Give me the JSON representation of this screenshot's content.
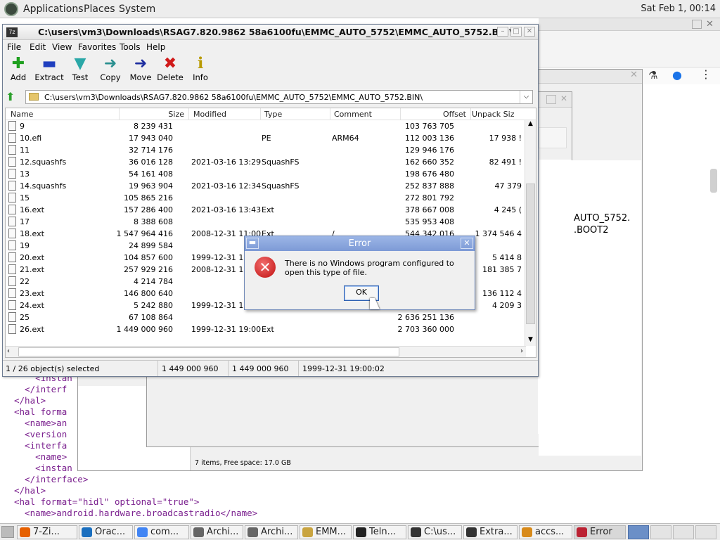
{
  "top_panel": {
    "applications": "Applications",
    "places": "Places",
    "system": "System",
    "clock": "Sat Feb 1, 00:14"
  },
  "window": {
    "title": "C:\\users\\vm3\\Downloads\\RSAG7.820.9862 58a6100fu\\EMMC_AUTO_5752\\EMMC_AUTO_5752.BIN\\",
    "menu": [
      "File",
      "Edit",
      "View",
      "Favorites",
      "Tools",
      "Help"
    ],
    "toolbar": [
      {
        "label": "Add",
        "icon": "add-icon"
      },
      {
        "label": "Extract",
        "icon": "extract-icon"
      },
      {
        "label": "Test",
        "icon": "test-icon"
      },
      {
        "label": "Copy",
        "icon": "copy-icon"
      },
      {
        "label": "Move",
        "icon": "move-icon"
      },
      {
        "label": "Delete",
        "icon": "delete-icon"
      },
      {
        "label": "Info",
        "icon": "info-icon"
      }
    ],
    "address": "C:\\users\\vm3\\Downloads\\RSAG7.820.9862 58a6100fu\\EMMC_AUTO_5752\\EMMC_AUTO_5752.BIN\\",
    "columns": [
      "Name",
      "Size",
      "Modified",
      "Type",
      "Comment",
      "Offset",
      "Unpack Siz"
    ],
    "rows": [
      [
        "9",
        "8 239 431",
        "",
        "",
        "",
        "103 763 705",
        ""
      ],
      [
        "10.efi",
        "17 943 040",
        "",
        "PE",
        "ARM64",
        "112 003 136",
        "17 938 !"
      ],
      [
        "11",
        "32 714 176",
        "",
        "",
        "",
        "129 946 176",
        ""
      ],
      [
        "12.squashfs",
        "36 016 128",
        "2021-03-16 13:29",
        "SquashFS",
        "",
        "162 660 352",
        "82 491 !"
      ],
      [
        "13",
        "54 161 408",
        "",
        "",
        "",
        "198 676 480",
        ""
      ],
      [
        "14.squashfs",
        "19 963 904",
        "2021-03-16 12:34",
        "SquashFS",
        "",
        "252 837 888",
        "47 379 "
      ],
      [
        "15",
        "105 865 216",
        "",
        "",
        "",
        "272 801 792",
        ""
      ],
      [
        "16.ext",
        "157 286 400",
        "2021-03-16 13:43",
        "Ext",
        "",
        "378 667 008",
        "4 245 ("
      ],
      [
        "17",
        "8 388 608",
        "",
        "",
        "",
        "535 953 408",
        ""
      ],
      [
        "18.ext",
        "1 547 964 416",
        "2008-12-31 11:00",
        "Ext",
        "/",
        "544 342 016",
        "1 374 546 4"
      ],
      [
        "19",
        "24 899 584",
        "",
        "",
        "",
        "",
        ""
      ],
      [
        "20.ext",
        "104 857 600",
        "1999-12-31 19:",
        "",
        "",
        "",
        "5 414 8"
      ],
      [
        "21.ext",
        "257 929 216",
        "2008-12-31 11:",
        "",
        "",
        "",
        "181 385 7"
      ],
      [
        "22",
        "4 214 784",
        "",
        "",
        "",
        "",
        ""
      ],
      [
        "23.ext",
        "146 800 640",
        "",
        "",
        "",
        "",
        "136 112 4"
      ],
      [
        "24.ext",
        "5 242 880",
        "1999-12-31 19:",
        "",
        "",
        "",
        "4 209 3"
      ],
      [
        "25",
        "67 108 864",
        "",
        "",
        "",
        "2 636 251 136",
        ""
      ],
      [
        "26.ext",
        "1 449 000 960",
        "1999-12-31 19:00",
        "Ext",
        "",
        "2 703 360 000",
        ""
      ]
    ],
    "status": {
      "selected": "1 / 26 object(s) selected",
      "size": "1 449 000 960",
      "packed": "1 449 000 960",
      "date": "1999-12-31 19:00:02"
    }
  },
  "bg_window": {
    "file_label_1": "AUTO_5752.",
    "file_label_2": ".BOOT2",
    "statusbar": "7 items, Free space: 17.0 GB"
  },
  "xml_lines": [
    "    <instan",
    "  </interf",
    "</hal>",
    "<hal forma",
    "  <name>an",
    "  <version",
    "  <interfa",
    "    <name>",
    "    <instan",
    "  </interface>",
    "</hal>",
    "<hal format=\"hidl\" optional=\"true\">",
    "  <name>android.hardware.broadcastradio</name>"
  ],
  "dialog": {
    "title": "Error",
    "message": "There is no Windows program configured to open this type of file.",
    "ok": "OK"
  },
  "taskbar": [
    {
      "label": "7-Zi...",
      "icon": "firefox-icon"
    },
    {
      "label": "Orac...",
      "icon": "virtualbox-icon"
    },
    {
      "label": "com...",
      "icon": "chrome-icon"
    },
    {
      "label": "Archi...",
      "icon": "archive-icon"
    },
    {
      "label": "Archi...",
      "icon": "archive-icon"
    },
    {
      "label": "EMM...",
      "icon": "folder-icon"
    },
    {
      "label": "Teln...",
      "icon": "terminal-icon"
    },
    {
      "label": "C:\\us...",
      "icon": "7zip-icon"
    },
    {
      "label": "Extra...",
      "icon": "7zip-icon"
    },
    {
      "label": "accs...",
      "icon": "editor-icon"
    },
    {
      "label": "Error",
      "icon": "error-icon"
    }
  ]
}
